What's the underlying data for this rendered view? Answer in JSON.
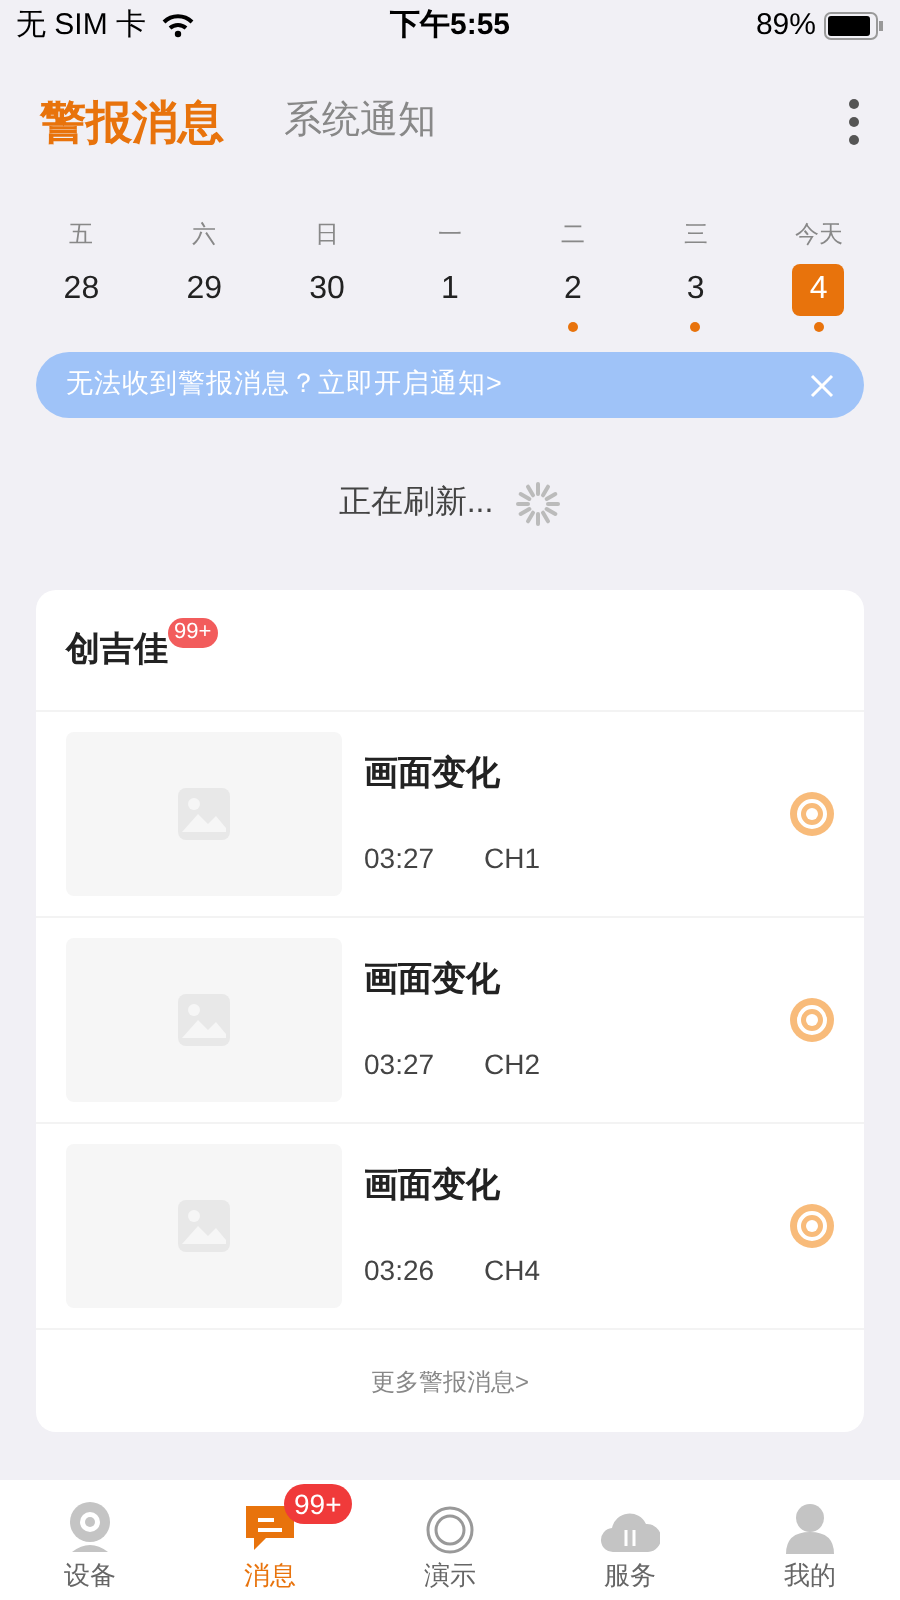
{
  "status_bar": {
    "carrier": "无 SIM 卡",
    "time": "下午5:55",
    "battery": "89%"
  },
  "tabs": [
    {
      "label": "警报消息",
      "selected": true
    },
    {
      "label": "系统通知",
      "selected": false
    }
  ],
  "calendar": [
    {
      "weekday": "五",
      "date": "28",
      "selected": false,
      "has_alert": false
    },
    {
      "weekday": "六",
      "date": "29",
      "selected": false,
      "has_alert": false
    },
    {
      "weekday": "日",
      "date": "30",
      "selected": false,
      "has_alert": false
    },
    {
      "weekday": "一",
      "date": "1",
      "selected": false,
      "has_alert": false
    },
    {
      "weekday": "二",
      "date": "2",
      "selected": false,
      "has_alert": true
    },
    {
      "weekday": "三",
      "date": "3",
      "selected": false,
      "has_alert": true
    },
    {
      "weekday": "今天",
      "date": "4",
      "selected": true,
      "has_alert": true
    }
  ],
  "banner": {
    "text": "无法收到警报消息？立即开启通知>"
  },
  "refresh": {
    "text": "正在刷新..."
  },
  "device": {
    "name": "创吉佳",
    "badge": "99+",
    "alerts": [
      {
        "title": "画面变化",
        "time": "03:27",
        "channel": "CH1"
      },
      {
        "title": "画面变化",
        "time": "03:27",
        "channel": "CH2"
      },
      {
        "title": "画面变化",
        "time": "03:26",
        "channel": "CH4"
      }
    ],
    "more": "更多警报消息>"
  },
  "bottom_nav": [
    {
      "kind": "camera",
      "label": "设备",
      "selected": false
    },
    {
      "kind": "message",
      "label": "消息",
      "selected": true,
      "badge": "99+"
    },
    {
      "kind": "demo",
      "label": "演示",
      "selected": false
    },
    {
      "kind": "cloud",
      "label": "服务",
      "selected": false
    },
    {
      "kind": "person",
      "label": "我的",
      "selected": false
    }
  ]
}
